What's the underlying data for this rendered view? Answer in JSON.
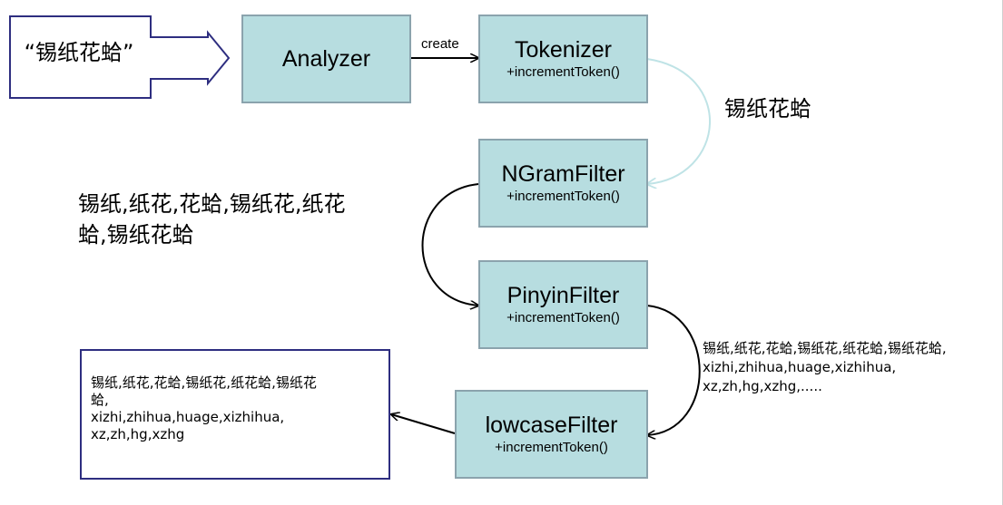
{
  "input": {
    "text": "“锡纸花蛤”"
  },
  "nodes": {
    "analyzer": {
      "title": "Analyzer"
    },
    "tokenizer": {
      "title": "Tokenizer",
      "method": "+incrementToken()"
    },
    "ngram": {
      "title": "NGramFilter",
      "method": "+incrementToken()"
    },
    "pinyin": {
      "title": "PinyinFilter",
      "method": "+incrementToken()"
    },
    "lowcase": {
      "title": "lowcaseFilter",
      "method": "+incrementToken()"
    }
  },
  "edges": {
    "create_label": "create"
  },
  "notes": {
    "tokenizer_output": "锡纸花蛤",
    "ngram_output": "锡纸,纸花,花蛤,锡纸花,纸花\n蛤,锡纸花蛤",
    "pinyin_output": "锡纸,纸花,花蛤,锡纸花,纸花蛤,锡纸花蛤,\nxizhi,zhihua,huage,xizhihua,\nxz,zh,hg,xzhg,.....",
    "final_output": "锡纸,纸花,花蛤,锡纸花,纸花蛤,锡纸花\n蛤,\nxizhi,zhihua,huage,xizhihua,\nxz,zh,hg,xzhg"
  },
  "colors": {
    "node_fill": "#b7dde0",
    "node_border": "#8ba3ad",
    "input_border": "#2e2e80",
    "arrow": "#000000",
    "light_arrow": "#bfe3e6"
  }
}
